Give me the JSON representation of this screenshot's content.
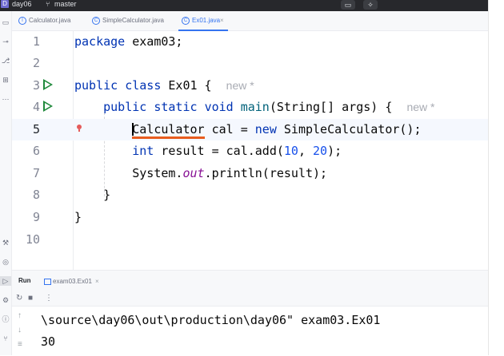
{
  "titlebar": {
    "project_badge": "D",
    "project_name": "day06",
    "branch_icon": "git-branch-icon",
    "branch_name": "master"
  },
  "tabs": [
    {
      "label": "Calculator.java",
      "icon": "interface-icon",
      "glyph": "I",
      "active": false
    },
    {
      "label": "SimpleCalculator.java",
      "icon": "class-icon",
      "glyph": "C",
      "active": false
    },
    {
      "label": "Ex01.java",
      "icon": "class-icon",
      "glyph": "C",
      "active": true
    }
  ],
  "tab_close": "×",
  "editor": {
    "line_numbers": [
      "1",
      "2",
      "3",
      "4",
      "5",
      "6",
      "7",
      "8",
      "9",
      "10"
    ],
    "current_line": "5",
    "code": {
      "l1_kw": "package",
      "l1_rest": " exam03;",
      "l3_kw1": "public",
      "l3_kw2": "class",
      "l3_name": " Ex01 {",
      "l3_hint": "new *",
      "l4_kw1": "public",
      "l4_kw2": "static",
      "l4_kw3": "void",
      "l4_fn": "main",
      "l4_rest": "(String[] args) {",
      "l4_hint": "new *",
      "l5_err": "Calculator",
      "l5_a": " cal = ",
      "l5_kw": "new",
      "l5_b": " SimpleCalculator();",
      "l6_kw": "int",
      "l6_a": " result = cal.add(",
      "l6_n1": "10",
      "l6_sep": ", ",
      "l6_n2": "20",
      "l6_b": ");",
      "l7_a": "System.",
      "l7_st": "out",
      "l7_b": ".println(result);",
      "l8": "}",
      "l9": "}"
    }
  },
  "run_panel": {
    "title": "Run",
    "tab_label": "exam03.Ex01",
    "console_lines": [
      "\\source\\day06\\out\\production\\day06\" exam03.Ex01",
      "30"
    ]
  },
  "colors": {
    "keyword": "#0033b3",
    "function": "#00627a",
    "number": "#1750eb",
    "static_field": "#871094",
    "error_underline": "#e85c1e",
    "run_icon": "#208a3c",
    "accent": "#3574f0"
  }
}
